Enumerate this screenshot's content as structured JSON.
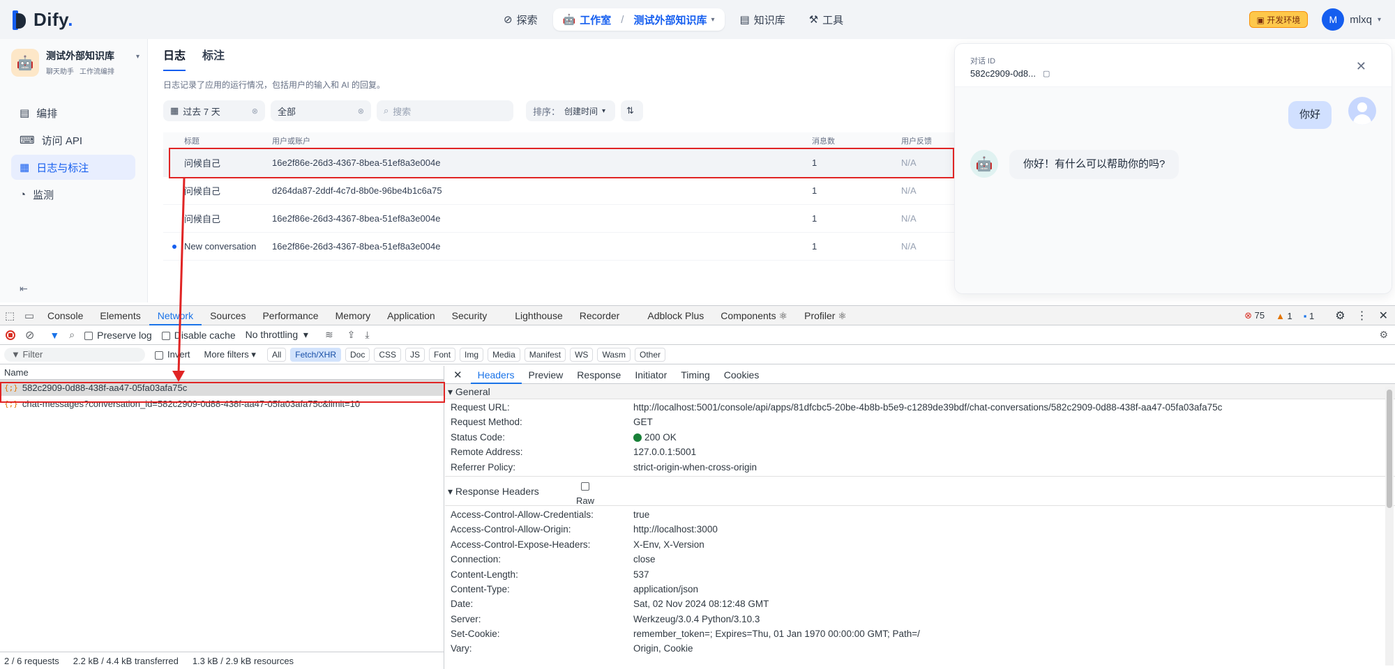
{
  "topnav": {
    "brand": "Dify",
    "explore": "探索",
    "studio": "工作室",
    "app_crumb": "测试外部知识库",
    "knowledge": "知识库",
    "tools": "工具",
    "env_badge": "开发环境",
    "avatar_letter": "M",
    "username": "mlxq"
  },
  "sidebar": {
    "app_name": "测试外部知识库",
    "tag_chat": "聊天助手",
    "tag_flow": "工作流编排",
    "items": [
      {
        "label": "编排",
        "icon": "layout-icon"
      },
      {
        "label": "访问 API",
        "icon": "terminal-icon"
      },
      {
        "label": "日志与标注",
        "icon": "file-text-icon"
      },
      {
        "label": "监测",
        "icon": "monitor-icon"
      }
    ]
  },
  "logs": {
    "tab_logs": "日志",
    "tab_annotations": "标注",
    "description": "日志记录了应用的运行情况，包括用户的输入和 AI 的回复。",
    "filter_period": "过去 7 天",
    "filter_status": "全部",
    "search_placeholder": "搜索",
    "sort_label": "排序：",
    "sort_value": "创建时间",
    "columns": {
      "title": "标题",
      "user": "用户或账户",
      "messages": "消息数",
      "feedback": "用户反馈"
    },
    "rows": [
      {
        "title": "问候自己",
        "user": "16e2f86e-26d3-4367-8bea-51ef8a3e004e",
        "count": "1",
        "feedback": "N/A"
      },
      {
        "title": "问候自己",
        "user": "d264da87-2ddf-4c7d-8b0e-96be4b1c6a75",
        "count": "1",
        "feedback": "N/A"
      },
      {
        "title": "问候自己",
        "user": "16e2f86e-26d3-4367-8bea-51ef8a3e004e",
        "count": "1",
        "feedback": "N/A"
      },
      {
        "title": "New conversation",
        "user": "16e2f86e-26d3-4367-8bea-51ef8a3e004e",
        "count": "1",
        "feedback": "N/A"
      }
    ]
  },
  "drawer": {
    "label": "对话 ID",
    "conv_id": "582c2909-0d8...",
    "user_msg": "你好",
    "bot_msg": "你好！有什么可以帮助你的吗?"
  },
  "devtools": {
    "tabs": [
      "Console",
      "Elements",
      "Network",
      "Sources",
      "Performance",
      "Memory",
      "Application",
      "Security",
      "Lighthouse",
      "Recorder",
      "Adblock Plus",
      "Components ⚛",
      "Profiler ⚛"
    ],
    "errors": "75",
    "warnings": "1",
    "infos": "1",
    "preserve_log": "Preserve log",
    "disable_cache": "Disable cache",
    "throttling": "No throttling",
    "filter_placeholder": "Filter",
    "invert": "Invert",
    "more_filters": "More filters",
    "chips": [
      "All",
      "Fetch/XHR",
      "Doc",
      "CSS",
      "JS",
      "Font",
      "Img",
      "Media",
      "Manifest",
      "WS",
      "Wasm",
      "Other"
    ],
    "name_header": "Name",
    "requests": [
      "582c2909-0d88-438f-aa47-05fa03afa75c",
      "chat-messages?conversation_id=582c2909-0d88-438f-aa47-05fa03afa75c&limit=10"
    ],
    "status_bar": {
      "requests": "2 / 6 requests",
      "transferred": "2.2 kB / 4.4 kB transferred",
      "resources": "1.3 kB / 2.9 kB resources"
    },
    "detail_tabs": [
      "Headers",
      "Preview",
      "Response",
      "Initiator",
      "Timing",
      "Cookies"
    ],
    "general_title": "General",
    "general": [
      {
        "k": "Request URL:",
        "v": "http://localhost:5001/console/api/apps/81dfcbc5-20be-4b8b-b5e9-c1289de39bdf/chat-conversations/582c2909-0d88-438f-aa47-05fa03afa75c"
      },
      {
        "k": "Request Method:",
        "v": "GET"
      },
      {
        "k": "Status Code:",
        "v": "200 OK"
      },
      {
        "k": "Remote Address:",
        "v": "127.0.0.1:5001"
      },
      {
        "k": "Referrer Policy:",
        "v": "strict-origin-when-cross-origin"
      }
    ],
    "response_title": "Response Headers",
    "raw_label": "Raw",
    "response_headers": [
      {
        "k": "Access-Control-Allow-Credentials:",
        "v": "true"
      },
      {
        "k": "Access-Control-Allow-Origin:",
        "v": "http://localhost:3000"
      },
      {
        "k": "Access-Control-Expose-Headers:",
        "v": "X-Env, X-Version"
      },
      {
        "k": "Connection:",
        "v": "close"
      },
      {
        "k": "Content-Length:",
        "v": "537"
      },
      {
        "k": "Content-Type:",
        "v": "application/json"
      },
      {
        "k": "Date:",
        "v": "Sat, 02 Nov 2024 08:12:48 GMT"
      },
      {
        "k": "Server:",
        "v": "Werkzeug/3.0.4 Python/3.10.3"
      },
      {
        "k": "Set-Cookie:",
        "v": "remember_token=; Expires=Thu, 01 Jan 1970 00:00:00 GMT; Path=/"
      },
      {
        "k": "Vary:",
        "v": "Origin, Cookie"
      }
    ]
  },
  "colors": {
    "accent": "#155eef",
    "annotation_red": "#e02424",
    "devtools_blue": "#1a73e8"
  }
}
